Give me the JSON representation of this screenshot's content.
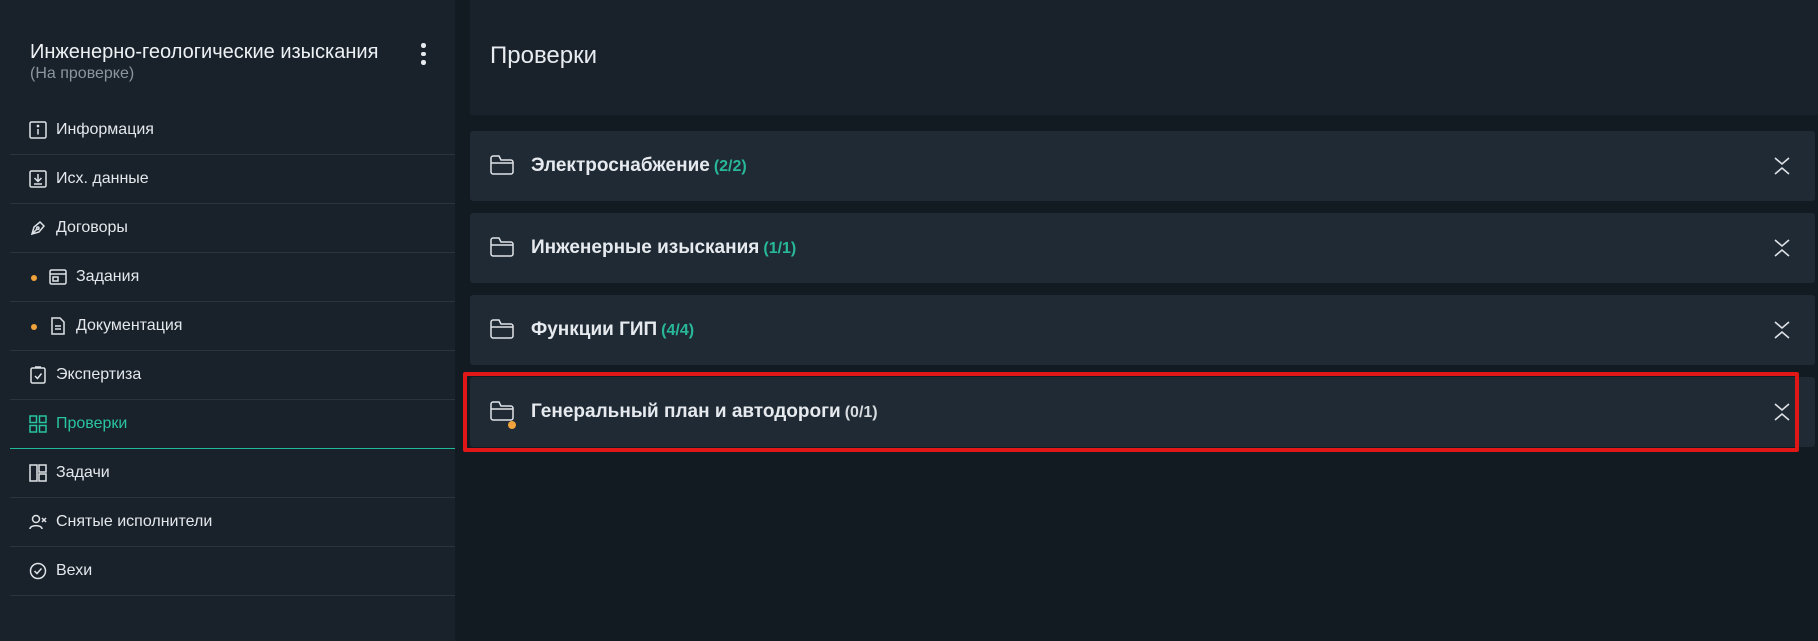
{
  "sidebar": {
    "project_title": "Инженерно-геологические изыскания",
    "project_status": "(На проверке)",
    "menu_icon": "kebab-vertical-icon",
    "items": [
      {
        "label": "Информация",
        "icon": "info-icon"
      },
      {
        "label": "Исх. данные",
        "icon": "download-box-icon"
      },
      {
        "label": "Договоры",
        "icon": "pen-nib-icon"
      },
      {
        "label": "Задания",
        "icon": "window-icon",
        "dot": true
      },
      {
        "label": "Документация",
        "icon": "document-icon",
        "dot": true
      },
      {
        "label": "Экспертиза",
        "icon": "clipboard-check-icon"
      },
      {
        "label": "Проверки",
        "icon": "grid-icon",
        "active": true
      },
      {
        "label": "Задачи",
        "icon": "kanban-icon"
      },
      {
        "label": "Снятые исполнители",
        "icon": "user-remove-icon"
      },
      {
        "label": "Вехи",
        "icon": "check-circle-icon"
      }
    ]
  },
  "main": {
    "title": "Проверки",
    "groups": [
      {
        "title": "Электроснабжение",
        "count": "(2/2)",
        "status": "done"
      },
      {
        "title": "Инженерные изыскания",
        "count": "(1/1)",
        "status": "done"
      },
      {
        "title": "Функции ГИП",
        "count": "(4/4)",
        "status": "done"
      },
      {
        "title": "Генеральный план и автодороги",
        "count": "(0/1)",
        "status": "pending",
        "highlighted": true
      }
    ]
  },
  "colors": {
    "accent": "#29c4a2",
    "dot": "#f0a23b",
    "highlight": "#e01717",
    "background": "#131b22",
    "panel": "#1f2a34"
  }
}
